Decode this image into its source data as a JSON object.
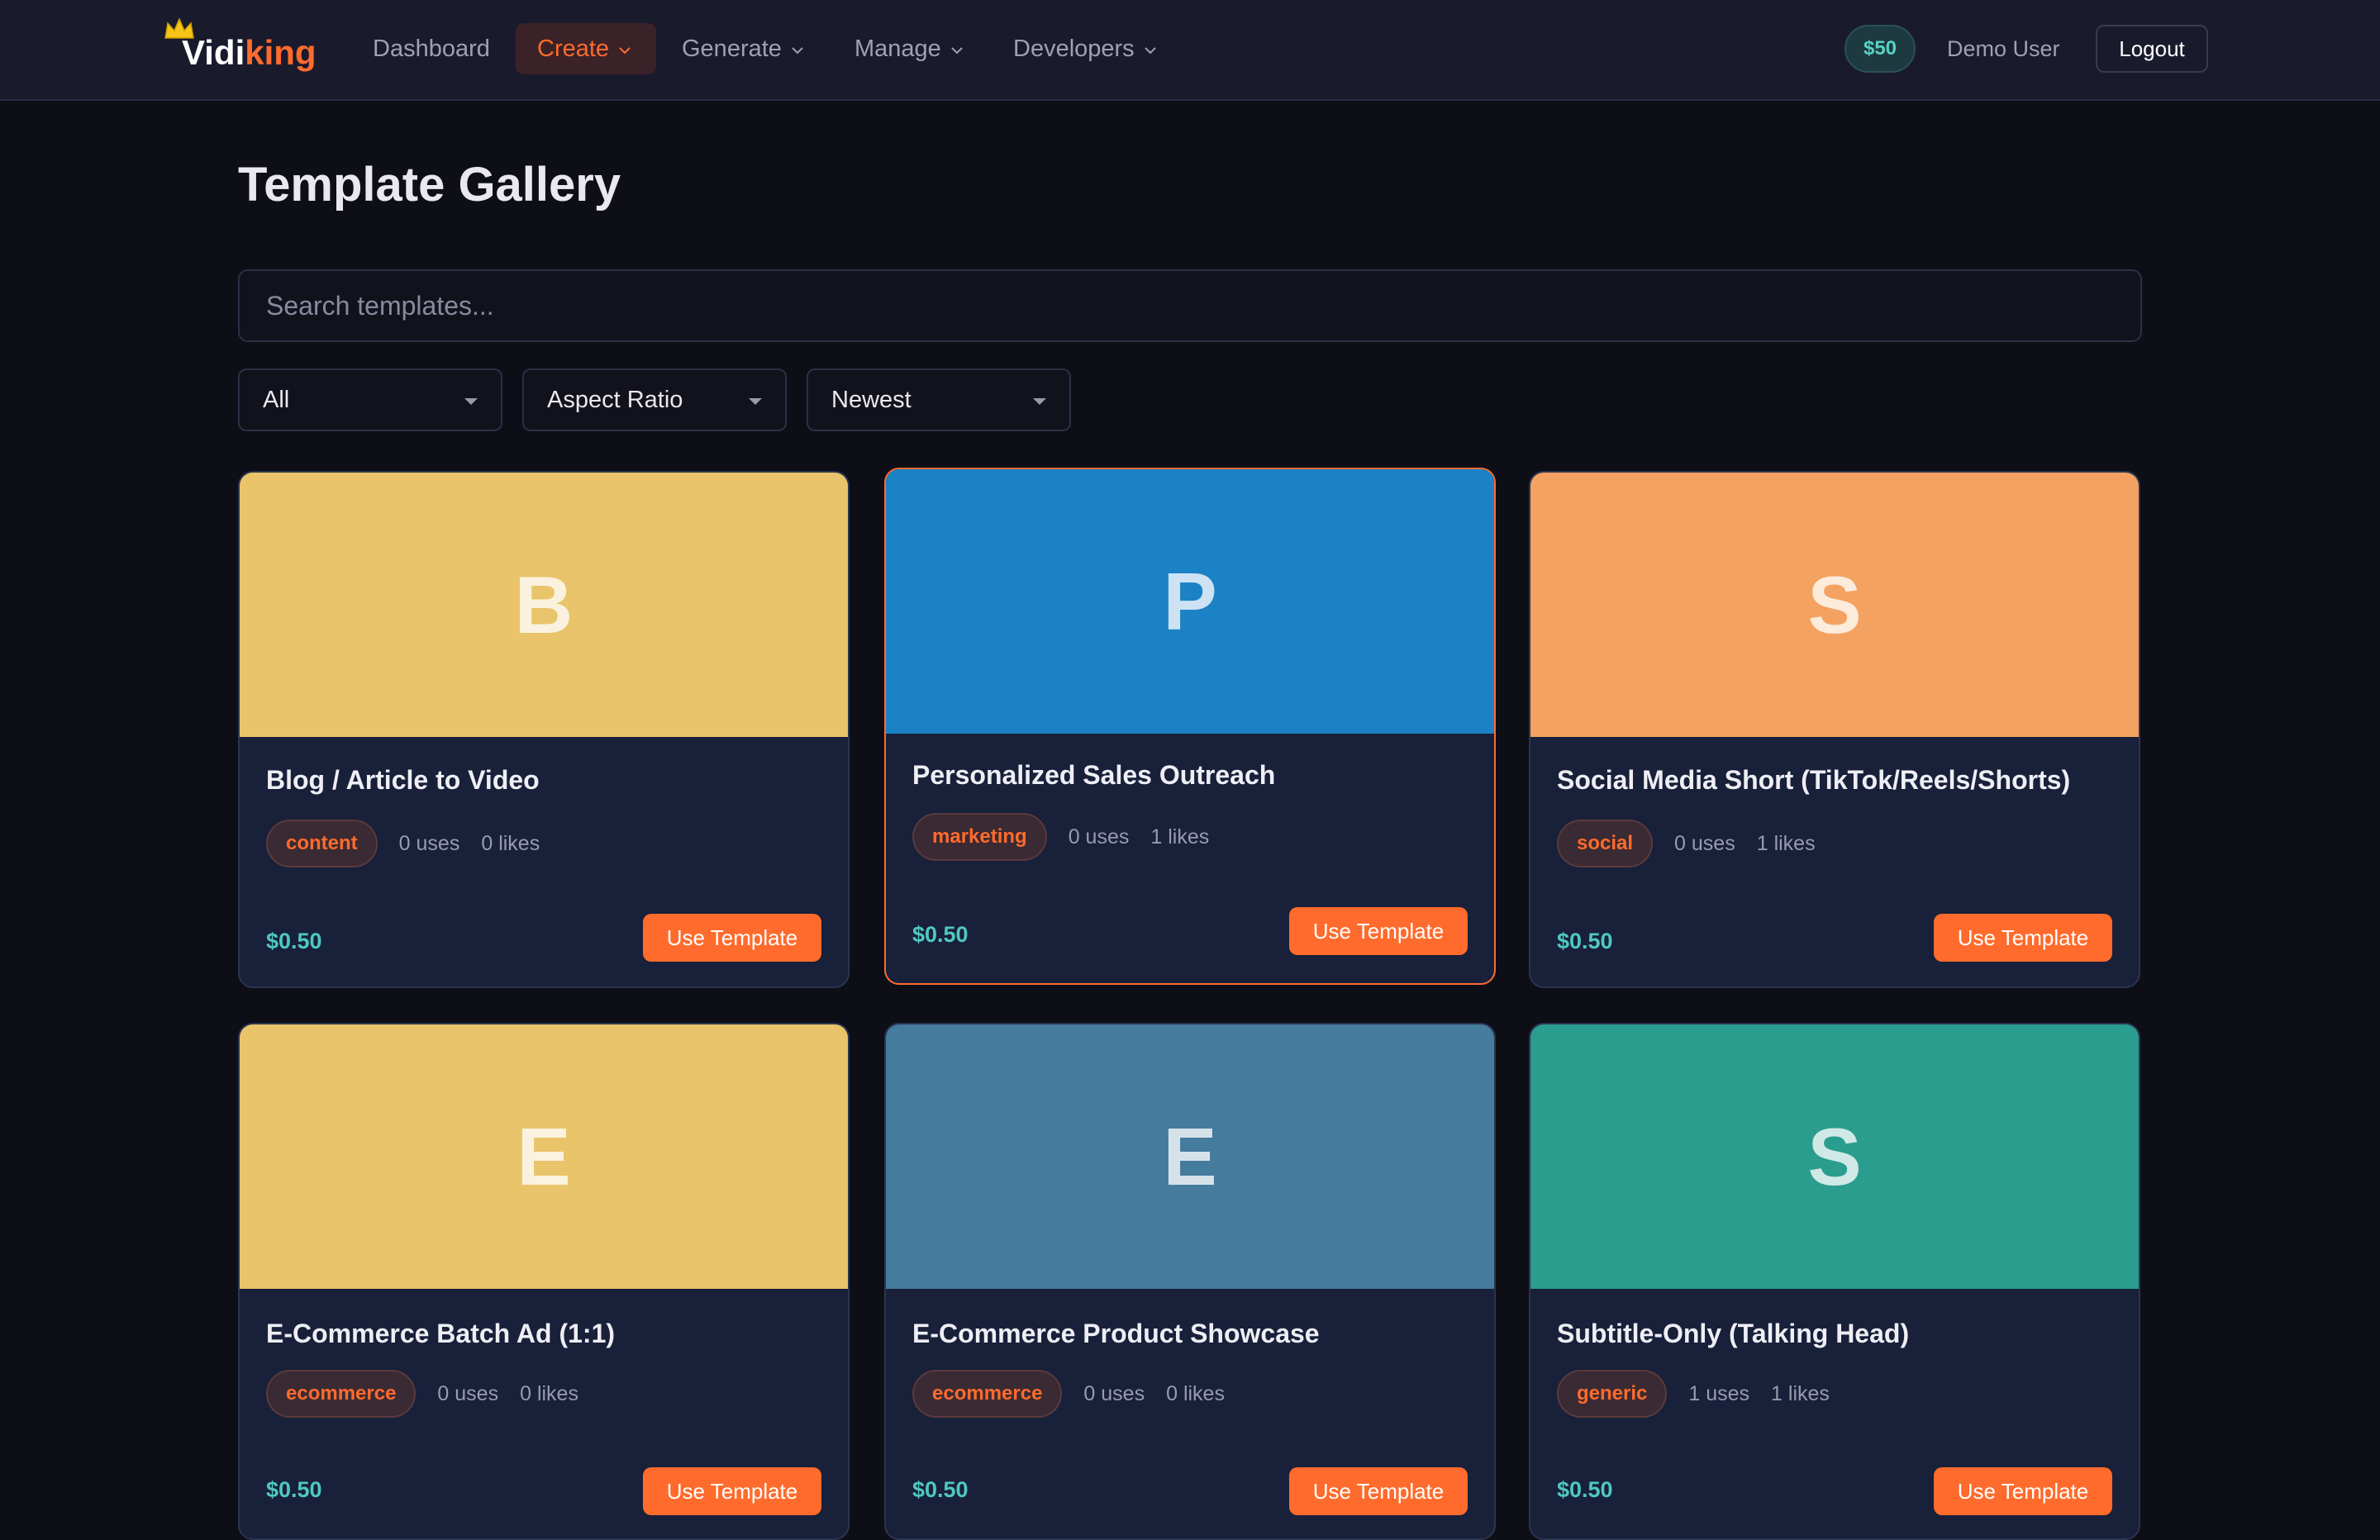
{
  "brand": {
    "part1": "Vidi",
    "part2": "king"
  },
  "nav": {
    "dashboard": "Dashboard",
    "create": "Create",
    "generate": "Generate",
    "manage": "Manage",
    "developers": "Developers"
  },
  "account": {
    "credits": "$50",
    "user": "Demo User",
    "logout": "Logout"
  },
  "page": {
    "title": "Template Gallery"
  },
  "search": {
    "placeholder": "Search templates..."
  },
  "filters": {
    "category": "All",
    "aspect": "Aspect Ratio",
    "sort": "Newest"
  },
  "colors": {
    "accent": "#ff6b2c",
    "price": "#4fc8bd"
  },
  "templates": [
    {
      "letter": "B",
      "color": "#e9c46a",
      "title": "Blog / Article to Video",
      "tag": "content",
      "uses": "0 uses",
      "likes": "0 likes",
      "price": "$0.50",
      "action": "Use Template"
    },
    {
      "letter": "P",
      "color": "#1b82c6",
      "title": "Personalized Sales Outreach",
      "tag": "marketing",
      "uses": "0 uses",
      "likes": "1 likes",
      "price": "$0.50",
      "action": "Use Template"
    },
    {
      "letter": "S",
      "color": "#f4a261",
      "title": "Social Media Short (TikTok/Reels/Shorts)",
      "tag": "social",
      "uses": "0 uses",
      "likes": "1 likes",
      "price": "$0.50",
      "action": "Use Template"
    },
    {
      "letter": "E",
      "color": "#e9c46a",
      "title": "E-Commerce Batch Ad (1:1)",
      "tag": "ecommerce",
      "uses": "0 uses",
      "likes": "0 likes",
      "price": "$0.50",
      "action": "Use Template"
    },
    {
      "letter": "E",
      "color": "#457b9d",
      "title": "E-Commerce Product Showcase",
      "tag": "ecommerce",
      "uses": "0 uses",
      "likes": "0 likes",
      "price": "$0.50",
      "action": "Use Template"
    },
    {
      "letter": "S",
      "color": "#2a9d8f",
      "title": "Subtitle-Only (Talking Head)",
      "tag": "generic",
      "uses": "1 uses",
      "likes": "1 likes",
      "price": "$0.50",
      "action": "Use Template"
    }
  ]
}
